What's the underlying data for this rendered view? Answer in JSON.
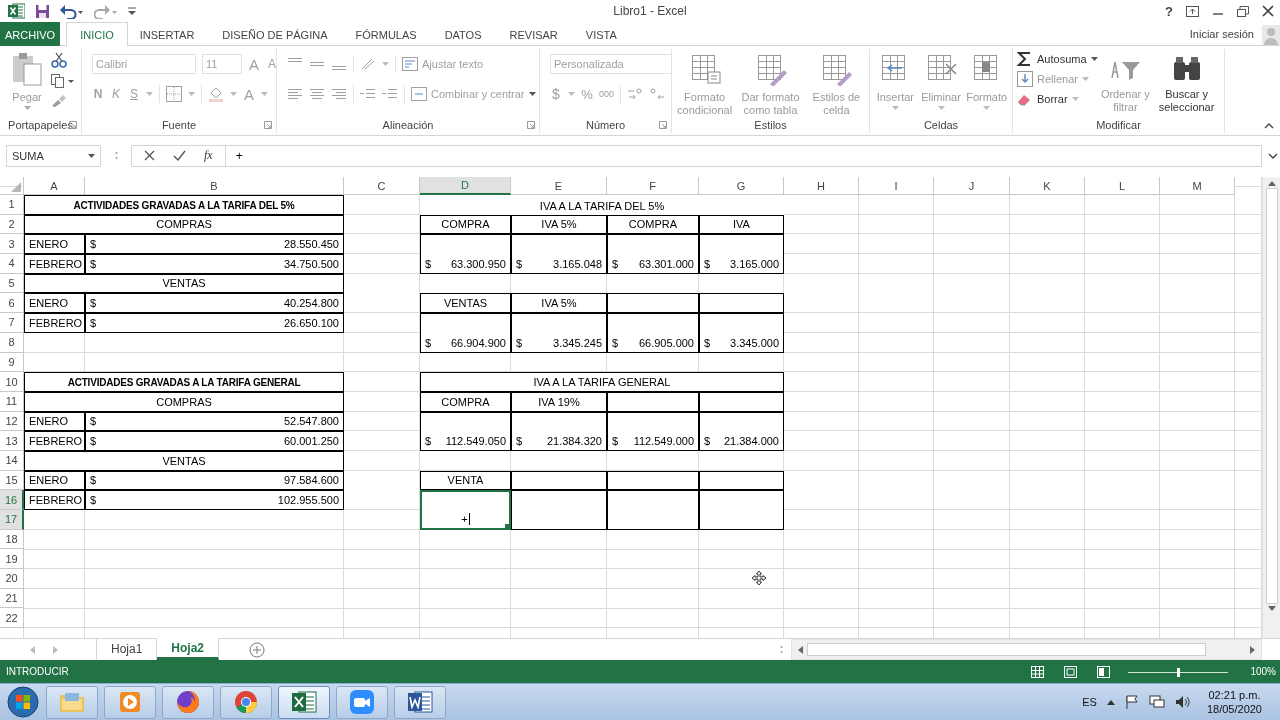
{
  "window": {
    "title": "Libro1 - Excel",
    "help": "?",
    "sign_in": "Iniciar sesión"
  },
  "ribbon_tabs": [
    {
      "label": "ARCHIVO",
      "kind": "file",
      "selected": false
    },
    {
      "label": "INICIO",
      "kind": "tab",
      "selected": true
    },
    {
      "label": "INSERTAR",
      "kind": "tab",
      "selected": false
    },
    {
      "label": "DISEÑO DE PÁGINA",
      "kind": "tab",
      "selected": false
    },
    {
      "label": "FÓRMULAS",
      "kind": "tab",
      "selected": false
    },
    {
      "label": "DATOS",
      "kind": "tab",
      "selected": false
    },
    {
      "label": "REVISAR",
      "kind": "tab",
      "selected": false
    },
    {
      "label": "VISTA",
      "kind": "tab",
      "selected": false
    }
  ],
  "ribbon": [
    {
      "kind": "clipboard",
      "label": "Portapapeles",
      "paste": "Pegar",
      "disabled": true
    },
    {
      "kind": "font",
      "label": "Fuente",
      "font": "Calibri",
      "size": "11",
      "grow": "A",
      "shrink": "A",
      "bold": "N",
      "italic": "K",
      "underline": "S",
      "font_color": "A",
      "disabled": true
    },
    {
      "kind": "alignment",
      "label": "Alineación",
      "wrap": "Ajustar texto",
      "merge": "Combinar y centrar",
      "disabled": true
    },
    {
      "kind": "number",
      "label": "Número",
      "format": "Personalizada",
      "currency": "$",
      "percent": "%",
      "thousands": "000",
      "disabled": true
    },
    {
      "kind": "styles",
      "label": "Estilos",
      "buttons": [
        {
          "label": "Formato condicional",
          "disabled": true
        },
        {
          "label": "Dar formato como tabla",
          "disabled": true
        },
        {
          "label": "Estilos de celda",
          "disabled": true
        }
      ]
    },
    {
      "kind": "cells",
      "label": "Celdas",
      "buttons": [
        {
          "label": "Insertar",
          "disabled": true
        },
        {
          "label": "Eliminar",
          "disabled": true
        },
        {
          "label": "Formato",
          "disabled": true
        }
      ]
    },
    {
      "kind": "editing",
      "label": "Modificar",
      "buttons": [
        {
          "label": "Autosuma",
          "disabled": false
        },
        {
          "label": "Rellenar",
          "disabled": true
        },
        {
          "label": "Borrar",
          "disabled": false
        },
        {
          "label": "Ordenar y filtrar",
          "disabled": true
        },
        {
          "label": "Buscar y seleccionar",
          "disabled": false
        }
      ]
    }
  ],
  "formula_bar": {
    "name_box": "SUMA",
    "fx": "fx",
    "formula": "+"
  },
  "columns": [
    {
      "label": "A",
      "selected": false
    },
    {
      "label": "B",
      "selected": false
    },
    {
      "label": "C",
      "selected": false
    },
    {
      "label": "D",
      "selected": true
    },
    {
      "label": "E",
      "selected": false
    },
    {
      "label": "F",
      "selected": false
    },
    {
      "label": "G",
      "selected": false
    },
    {
      "label": "H",
      "selected": false
    },
    {
      "label": "I",
      "selected": false
    },
    {
      "label": "J",
      "selected": false
    },
    {
      "label": "K",
      "selected": false
    },
    {
      "label": "L",
      "selected": false
    },
    {
      "label": "M",
      "selected": false
    }
  ],
  "rows": [
    {
      "label": "1",
      "selected": false
    },
    {
      "label": "2",
      "selected": false
    },
    {
      "label": "3",
      "selected": false
    },
    {
      "label": "4",
      "selected": false
    },
    {
      "label": "5",
      "selected": false
    },
    {
      "label": "6",
      "selected": false
    },
    {
      "label": "7",
      "selected": false
    },
    {
      "label": "8",
      "selected": false
    },
    {
      "label": "9",
      "selected": false
    },
    {
      "label": "10",
      "selected": false
    },
    {
      "label": "11",
      "selected": false
    },
    {
      "label": "12",
      "selected": false
    },
    {
      "label": "13",
      "selected": false
    },
    {
      "label": "14",
      "selected": false
    },
    {
      "label": "15",
      "selected": false
    },
    {
      "label": "16",
      "selected": true
    },
    {
      "label": "17",
      "selected": true
    },
    {
      "label": "18",
      "selected": false
    },
    {
      "label": "19",
      "selected": false
    },
    {
      "label": "20",
      "selected": false
    },
    {
      "label": "21",
      "selected": false
    },
    {
      "label": "22",
      "selected": false
    }
  ],
  "cells": [
    {
      "kind": "title",
      "text": "ACTIVIDADES GRAVADAS A LA TARIFA DEL 5%",
      "border": true,
      "selected": false
    },
    {
      "kind": "heading",
      "text": "COMPRAS",
      "border": true,
      "selected": false
    },
    {
      "kind": "label",
      "text": "ENERO",
      "border": true,
      "selected": false
    },
    {
      "kind": "amount",
      "currency": "$",
      "value": "28.550.450",
      "border": true,
      "selected": false
    },
    {
      "kind": "label",
      "text": "FEBRERO",
      "border": true,
      "selected": false
    },
    {
      "kind": "amount",
      "currency": "$",
      "value": "34.750.500",
      "border": true,
      "selected": false
    },
    {
      "kind": "heading",
      "text": "VENTAS",
      "border": true,
      "selected": false
    },
    {
      "kind": "label",
      "text": "ENERO",
      "border": true,
      "selected": false
    },
    {
      "kind": "amount",
      "currency": "$",
      "value": "40.254.800",
      "border": true,
      "selected": false
    },
    {
      "kind": "label",
      "text": "FEBRERO",
      "border": true,
      "selected": false
    },
    {
      "kind": "amount",
      "currency": "$",
      "value": "26.650.100",
      "border": true,
      "selected": false
    },
    {
      "kind": "title",
      "text": "ACTIVIDADES GRAVADAS A LA TARIFA GENERAL",
      "border": true,
      "selected": false
    },
    {
      "kind": "heading",
      "text": "COMPRAS",
      "border": true,
      "selected": false
    },
    {
      "kind": "label",
      "text": "ENERO",
      "border": true,
      "selected": false
    },
    {
      "kind": "amount",
      "currency": "$",
      "value": "52.547.800",
      "border": true,
      "selected": false
    },
    {
      "kind": "label",
      "text": "FEBRERO",
      "border": true,
      "selected": false
    },
    {
      "kind": "amount",
      "currency": "$",
      "value": "60.001.250",
      "border": true,
      "selected": false
    },
    {
      "kind": "heading",
      "text": "VENTAS",
      "border": true,
      "selected": false
    },
    {
      "kind": "label",
      "text": "ENERO",
      "border": true,
      "selected": false
    },
    {
      "kind": "amount",
      "currency": "$",
      "value": "97.584.600",
      "border": true,
      "selected": false
    },
    {
      "kind": "label",
      "text": "FEBRERO",
      "border": true,
      "selected": false
    },
    {
      "kind": "amount",
      "currency": "$",
      "value": "102.955.500",
      "border": true,
      "selected": false
    },
    {
      "kind": "heading",
      "text": "IVA A LA TARIFA DEL 5%",
      "border": false,
      "selected": false
    },
    {
      "kind": "heading",
      "text": "COMPRA",
      "border": true,
      "selected": false
    },
    {
      "kind": "heading",
      "text": "IVA 5%",
      "border": true,
      "selected": false
    },
    {
      "kind": "heading",
      "text": "COMPRA",
      "border": true,
      "selected": false
    },
    {
      "kind": "heading",
      "text": "IVA",
      "border": true,
      "selected": false
    },
    {
      "kind": "amount",
      "currency": "$",
      "value": "63.300.950",
      "border": true,
      "selected": false
    },
    {
      "kind": "amount",
      "currency": "$",
      "value": "3.165.048",
      "border": true,
      "selected": false
    },
    {
      "kind": "amount",
      "currency": "$",
      "value": "63.301.000",
      "border": true,
      "selected": false
    },
    {
      "kind": "amount",
      "currency": "$",
      "value": "3.165.000",
      "border": true,
      "selected": false
    },
    {
      "kind": "heading",
      "text": "VENTAS",
      "border": true,
      "selected": false
    },
    {
      "kind": "heading",
      "text": "IVA 5%",
      "border": true,
      "selected": false
    },
    {
      "kind": "empty",
      "border": true,
      "selected": false
    },
    {
      "kind": "empty",
      "border": true,
      "selected": false
    },
    {
      "kind": "amount",
      "currency": "$",
      "value": "66.904.900",
      "border": true,
      "selected": false
    },
    {
      "kind": "amount",
      "currency": "$",
      "value": "3.345.245",
      "border": true,
      "selected": false
    },
    {
      "kind": "amount",
      "currency": "$",
      "value": "66.905.000",
      "border": true,
      "selected": false
    },
    {
      "kind": "amount",
      "currency": "$",
      "value": "3.345.000",
      "border": true,
      "selected": false
    },
    {
      "kind": "heading",
      "text": "IVA A LA TARIFA GENERAL",
      "border": true,
      "selected": false
    },
    {
      "kind": "heading",
      "text": "COMPRA",
      "border": true,
      "selected": false
    },
    {
      "kind": "heading",
      "text": "IVA 19%",
      "border": true,
      "selected": false
    },
    {
      "kind": "empty",
      "border": true,
      "selected": false
    },
    {
      "kind": "empty",
      "border": true,
      "selected": false
    },
    {
      "kind": "amount",
      "currency": "$",
      "value": "112.549.050",
      "border": true,
      "selected": false
    },
    {
      "kind": "amount",
      "currency": "$",
      "value": "21.384.320",
      "border": true,
      "selected": false
    },
    {
      "kind": "amount",
      "currency": "$",
      "value": "112.549.000",
      "border": true,
      "selected": false
    },
    {
      "kind": "amount",
      "currency": "$",
      "value": "21.384.000",
      "border": true,
      "selected": false
    },
    {
      "kind": "heading",
      "text": "VENTA",
      "border": true,
      "selected": false
    },
    {
      "kind": "empty",
      "border": true,
      "selected": false
    },
    {
      "kind": "empty",
      "border": true,
      "selected": false
    },
    {
      "kind": "empty",
      "border": true,
      "selected": false
    },
    {
      "kind": "heading",
      "text": "+",
      "border": true,
      "selected": true
    },
    {
      "kind": "empty",
      "border": true,
      "selected": false
    },
    {
      "kind": "empty",
      "border": true,
      "selected": false
    },
    {
      "kind": "empty",
      "border": true,
      "selected": false
    }
  ],
  "sheet_tabs": [
    {
      "label": "Hoja1",
      "selected": false
    },
    {
      "label": "Hoja2",
      "selected": true
    }
  ],
  "status_bar": {
    "mode": "INTRODUCIR",
    "zoom": {
      "level": 0.5,
      "reading": "100%"
    }
  },
  "taskbar": {
    "apps": [
      {
        "kind": "folder",
        "active": false
      },
      {
        "kind": "media",
        "active": false
      },
      {
        "kind": "firefox",
        "active": false
      },
      {
        "kind": "chrome",
        "active": false
      },
      {
        "kind": "excel",
        "active": true
      },
      {
        "kind": "camera",
        "active": false
      },
      {
        "kind": "word",
        "active": false
      }
    ],
    "language": "ES",
    "time": "02:21 p.m.",
    "date": "18/05/2020"
  }
}
